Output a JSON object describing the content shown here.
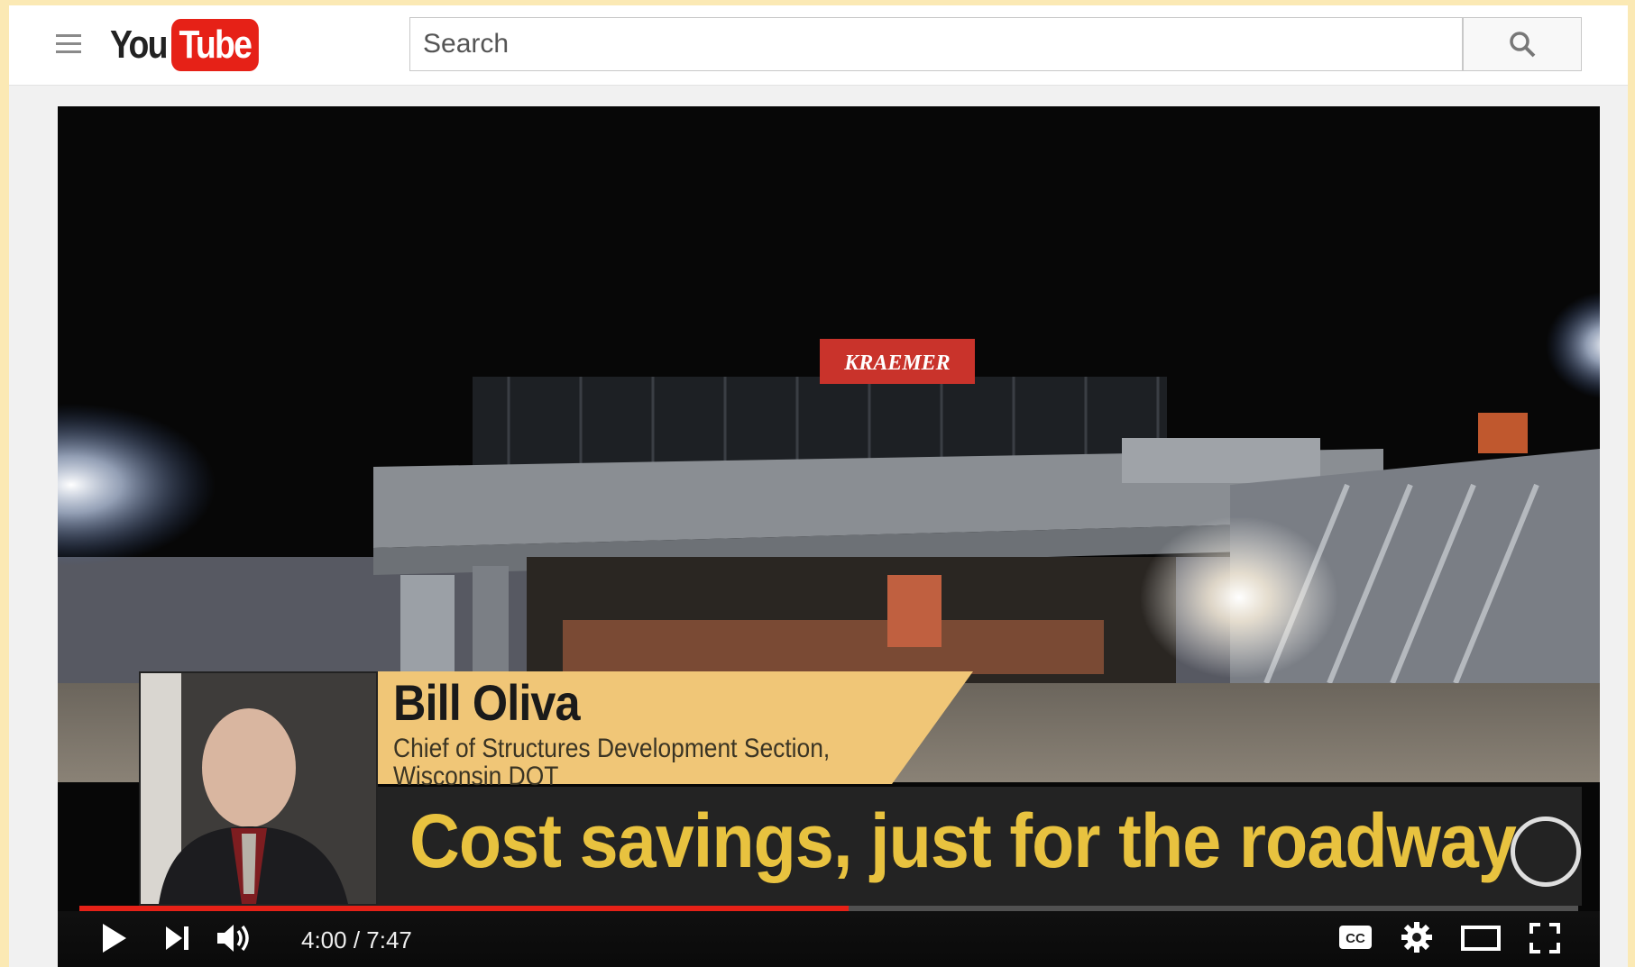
{
  "masthead": {
    "logo_you": "You",
    "logo_tube": "Tube",
    "search_placeholder": "Search"
  },
  "video": {
    "lower_third": {
      "name": "Bill Oliva",
      "role_line1": "Chief of Structures Development Section,",
      "role_line2": "Wisconsin DOT"
    },
    "caption": "Cost savings, just for the roadway",
    "sign_text": "KRAEMER"
  },
  "player": {
    "current_time": "4:00",
    "duration": "7:47",
    "time_display": "4:00 / 7:47",
    "progress": 0.513
  },
  "colors": {
    "brand_red": "#e62117",
    "caption_yellow": "#e8c23f",
    "name_band": "#f0c677"
  }
}
